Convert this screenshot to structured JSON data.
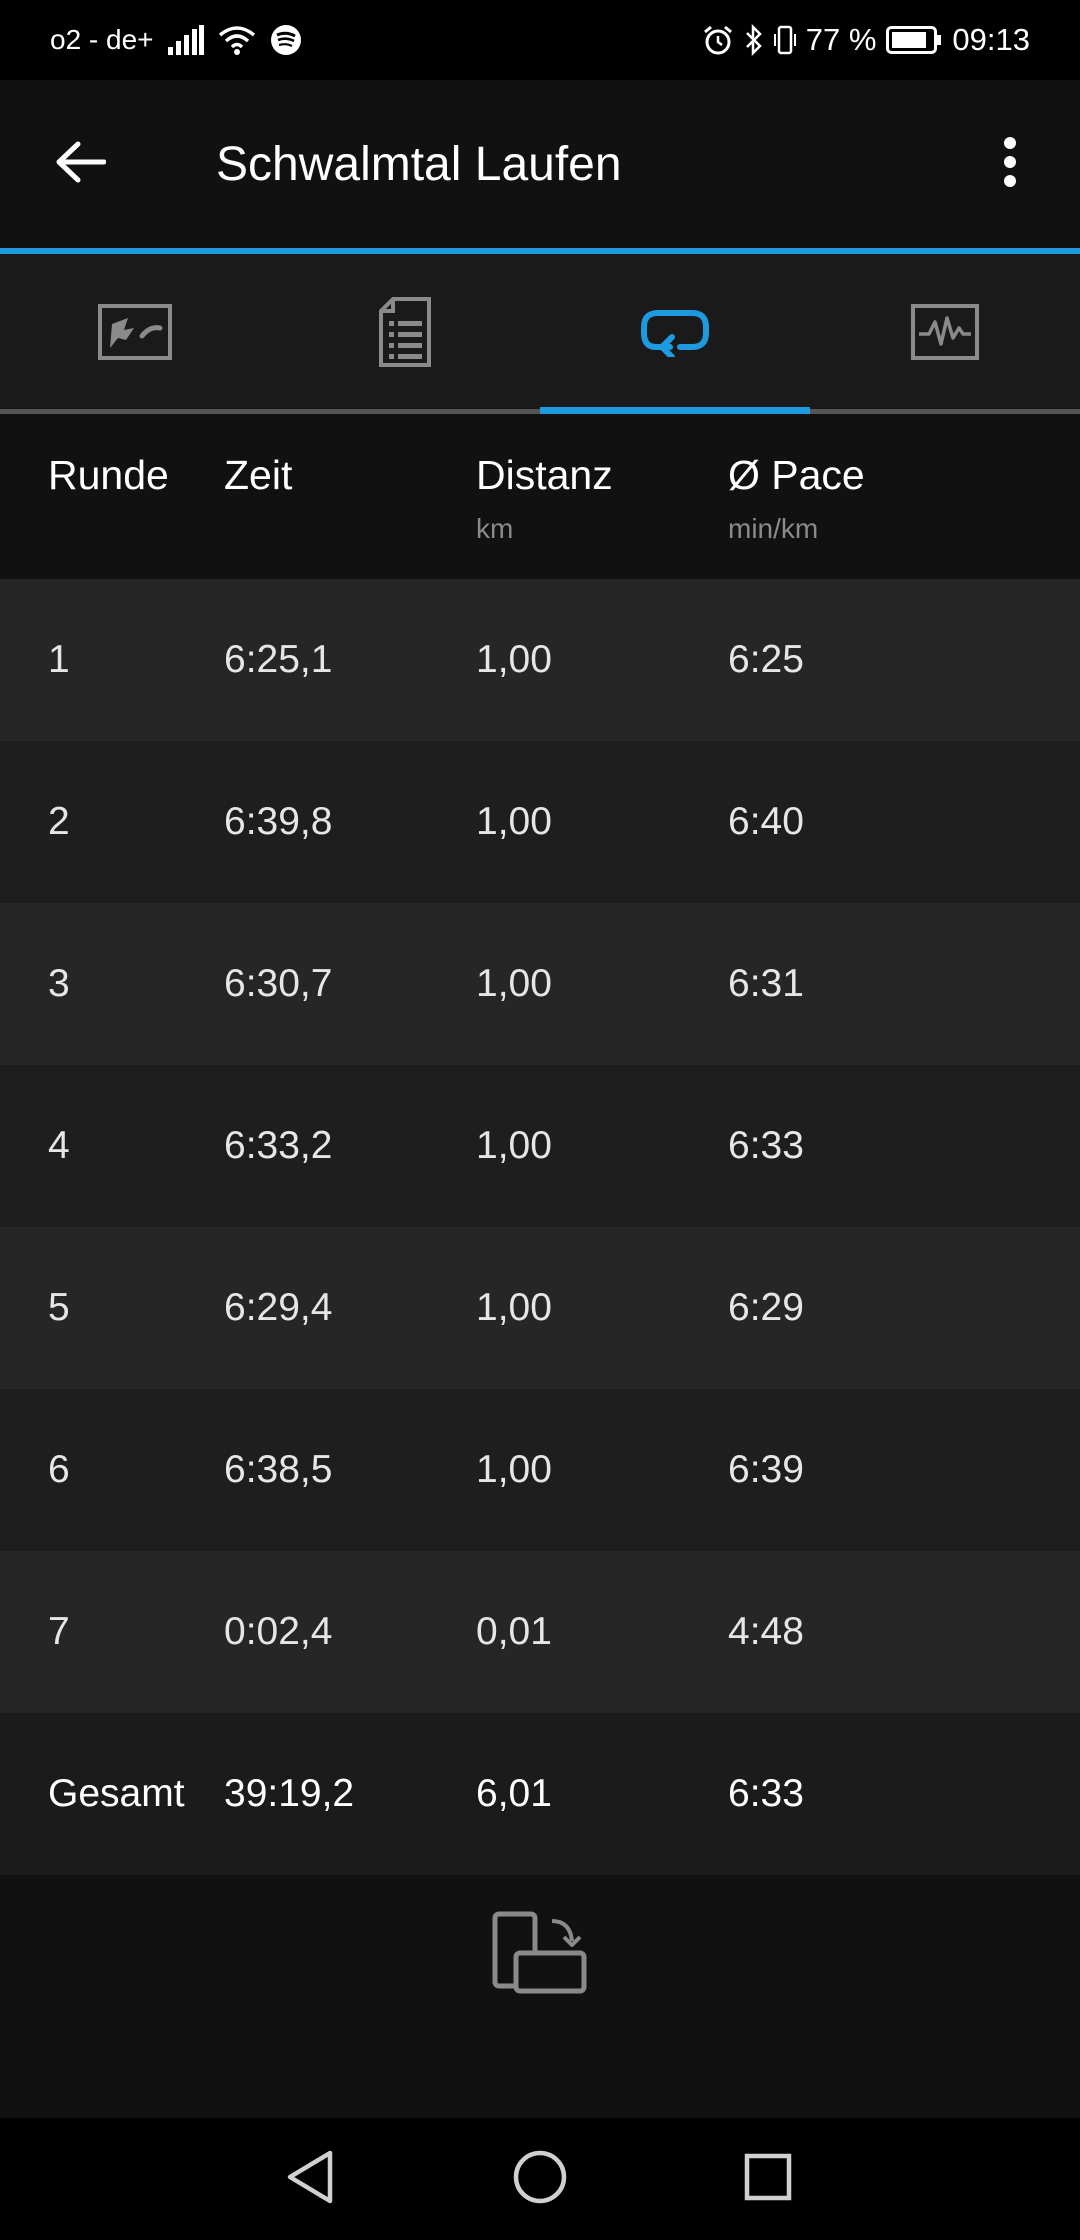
{
  "status_bar": {
    "carrier": "o2 - de+",
    "battery_percent": "77 %",
    "time": "09:13",
    "icons": [
      "signal-icon",
      "wifi-icon",
      "spotify-icon",
      "alarm-icon",
      "bluetooth-icon",
      "vibrate-icon",
      "battery-icon"
    ]
  },
  "app_bar": {
    "title": "Schwalmtal Laufen"
  },
  "tabs": [
    {
      "name": "map-tab",
      "icon": "map-icon",
      "active": false
    },
    {
      "name": "details-tab",
      "icon": "document-list-icon",
      "active": false
    },
    {
      "name": "laps-tab",
      "icon": "laps-icon",
      "active": true
    },
    {
      "name": "charts-tab",
      "icon": "chart-icon",
      "active": false
    }
  ],
  "colors": {
    "accent": "#1e9be0",
    "row_light": "#262626",
    "row_dark": "#1e1e1e"
  },
  "table": {
    "headers": {
      "lap": "Runde",
      "time": "Zeit",
      "distance": "Distanz",
      "distance_unit": "km",
      "pace": "Ø Pace",
      "pace_unit": "min/km"
    },
    "rows": [
      {
        "lap": "1",
        "time": "6:25,1",
        "distance": "1,00",
        "pace": "6:25"
      },
      {
        "lap": "2",
        "time": "6:39,8",
        "distance": "1,00",
        "pace": "6:40"
      },
      {
        "lap": "3",
        "time": "6:30,7",
        "distance": "1,00",
        "pace": "6:31"
      },
      {
        "lap": "4",
        "time": "6:33,2",
        "distance": "1,00",
        "pace": "6:33"
      },
      {
        "lap": "5",
        "time": "6:29,4",
        "distance": "1,00",
        "pace": "6:29"
      },
      {
        "lap": "6",
        "time": "6:38,5",
        "distance": "1,00",
        "pace": "6:39"
      },
      {
        "lap": "7",
        "time": "0:02,4",
        "distance": "0,01",
        "pace": "4:48"
      }
    ],
    "total": {
      "lap": "Gesamt",
      "time": "39:19,2",
      "distance": "6,01",
      "pace": "6:33"
    }
  }
}
